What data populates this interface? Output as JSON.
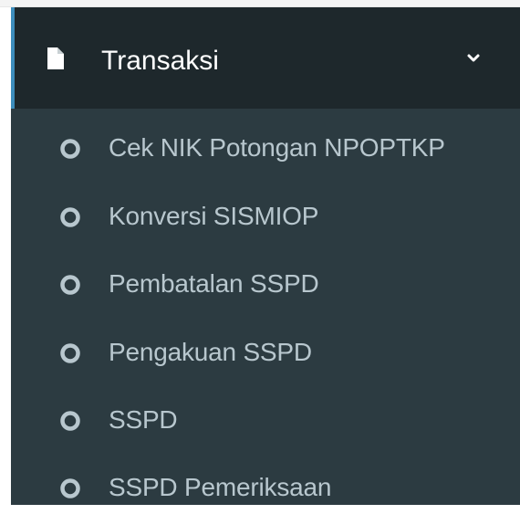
{
  "sidebar": {
    "section": {
      "label": "Transaksi",
      "icon": "file-icon",
      "expanded_icon": "chevron-down-icon"
    },
    "items": [
      {
        "label": "Cek NIK Potongan NPOPTKP",
        "icon": "circle-outline-icon"
      },
      {
        "label": "Konversi SISMIOP",
        "icon": "circle-outline-icon"
      },
      {
        "label": "Pembatalan SSPD",
        "icon": "circle-outline-icon"
      },
      {
        "label": "Pengakuan SSPD",
        "icon": "circle-outline-icon"
      },
      {
        "label": "SSPD",
        "icon": "circle-outline-icon"
      },
      {
        "label": "SSPD Pemeriksaan",
        "icon": "circle-outline-icon"
      }
    ],
    "colors": {
      "header_bg": "#1e282c",
      "menu_bg": "#2c3b41",
      "accent": "#3c8dbc",
      "item_text": "#b8c7ce",
      "header_text": "#ffffff"
    }
  }
}
